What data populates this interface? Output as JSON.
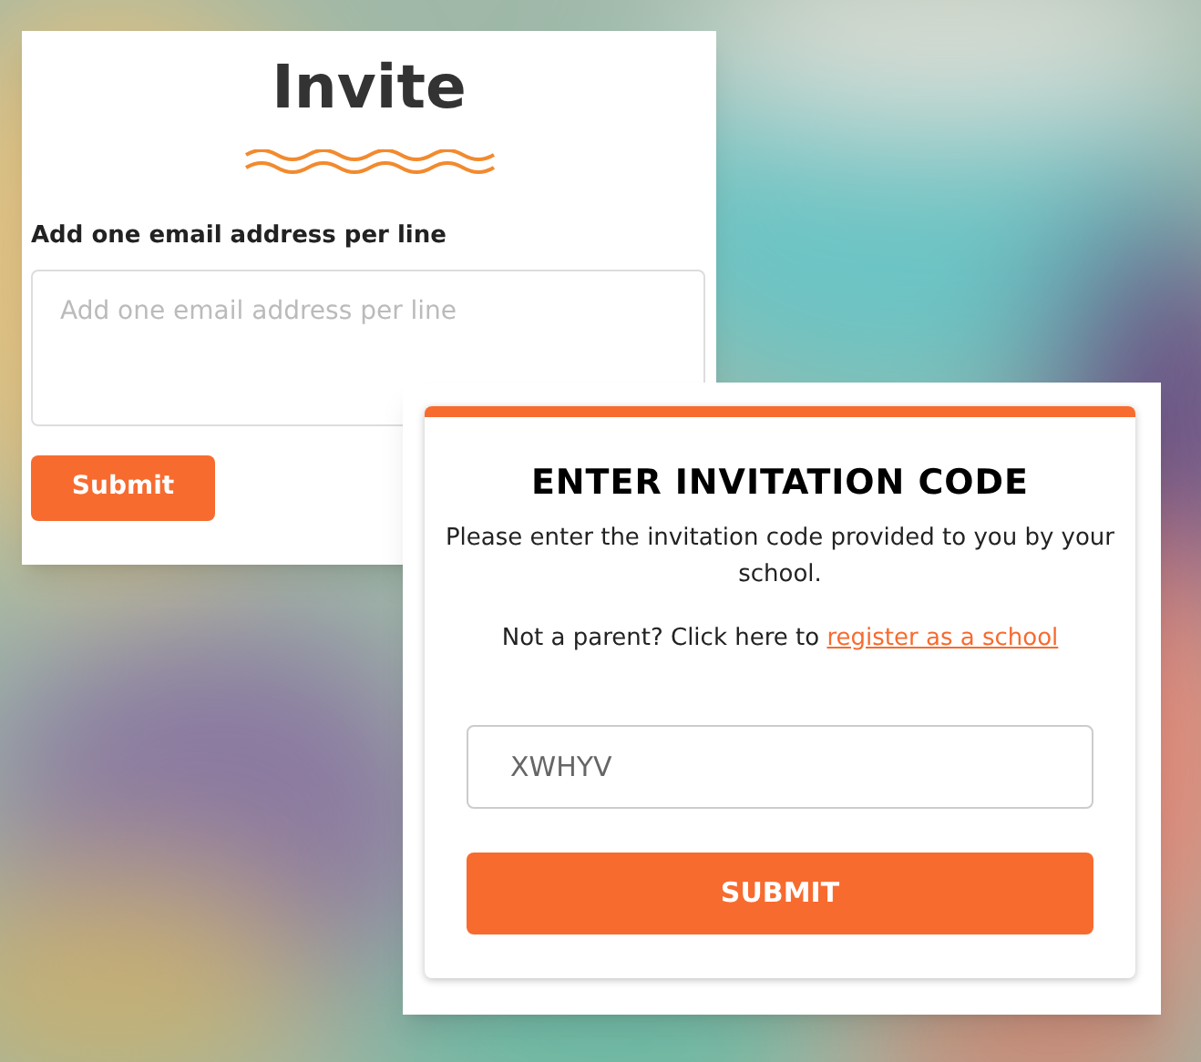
{
  "invite_panel": {
    "title": "Invite",
    "field_label": "Add one email address per line",
    "email_field": {
      "placeholder": "Add one email address per line"
    },
    "submit_button": "Submit"
  },
  "code_panel": {
    "title": "ENTER INVITATION CODE",
    "instructions": "Please enter the invitation code provided to you by your school.",
    "register_prompt": "Not a parent? Click here to",
    "register_link": "register as a school",
    "code_field": {
      "value": "XWHYV"
    },
    "submit_button": "SUBMIT"
  }
}
